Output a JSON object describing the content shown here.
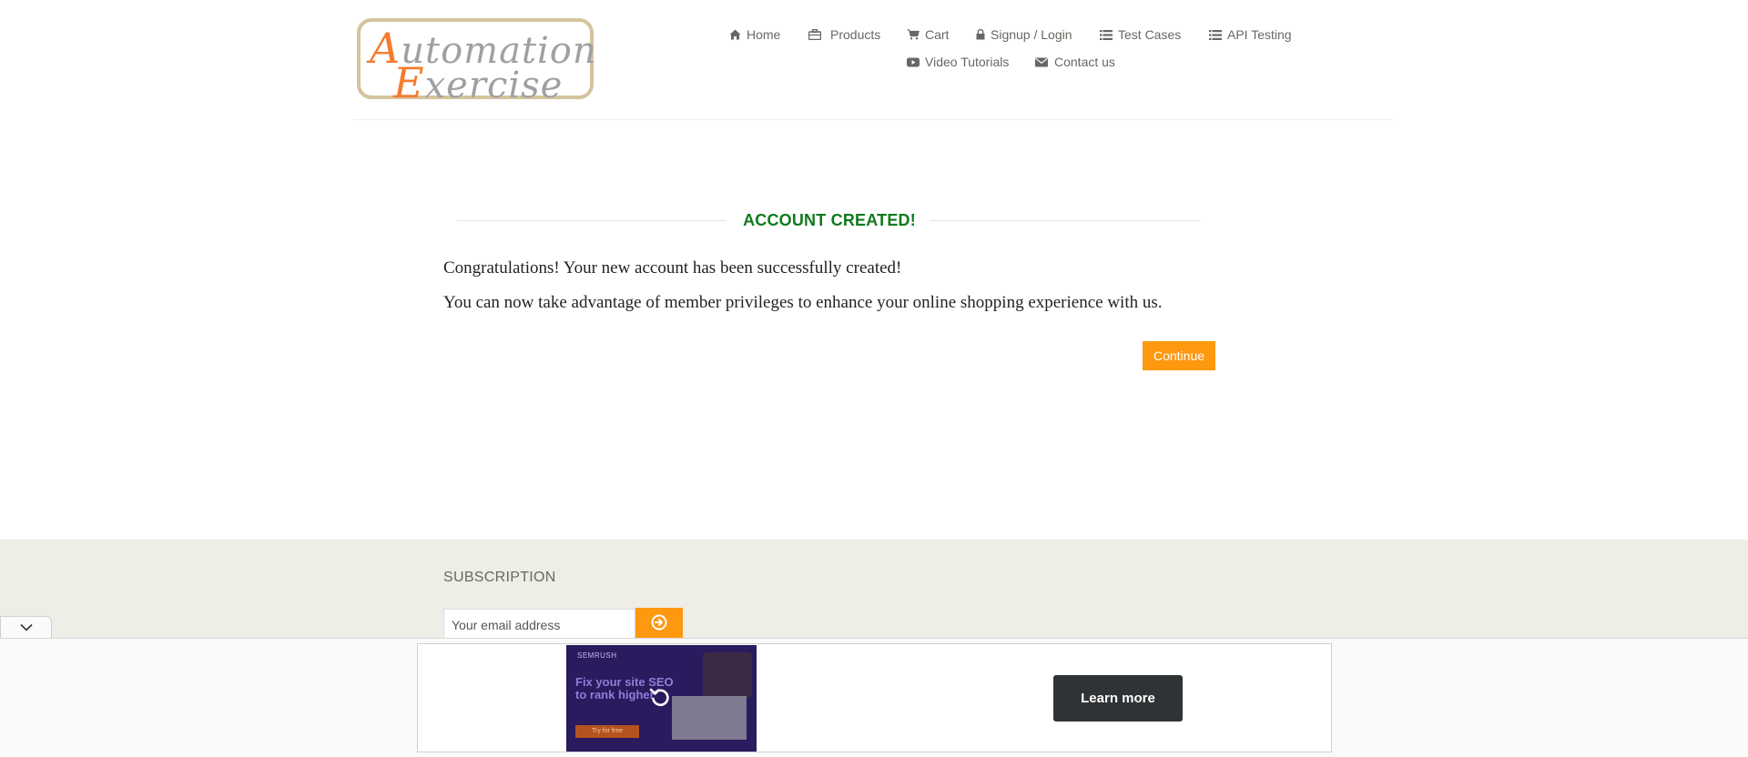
{
  "header": {
    "logo": {
      "line1": "Automation",
      "line2": "Exercise"
    },
    "nav": [
      {
        "id": "home",
        "label": "Home",
        "icon": "home-icon"
      },
      {
        "id": "products",
        "label": "Products",
        "icon": "briefcase-icon"
      },
      {
        "id": "cart",
        "label": "Cart",
        "icon": "cart-icon"
      },
      {
        "id": "signup",
        "label": "Signup / Login",
        "icon": "lock-icon"
      },
      {
        "id": "testcases",
        "label": "Test Cases",
        "icon": "list-icon"
      },
      {
        "id": "apitesting",
        "label": "API Testing",
        "icon": "list-icon"
      },
      {
        "id": "videos",
        "label": "Video Tutorials",
        "icon": "youtube-icon"
      },
      {
        "id": "contact",
        "label": "Contact us",
        "icon": "envelope-icon"
      }
    ]
  },
  "main": {
    "title": "ACCOUNT CREATED!",
    "message1": "Congratulations! Your new account has been successfully created!",
    "message2": "You can now take advantage of member privileges to enhance your online shopping experience with us.",
    "continue_label": "Continue"
  },
  "footer": {
    "subscription_title": "SUBSCRIPTION",
    "email_placeholder": "Your email address"
  },
  "ad": {
    "brand": "SEMRUSH",
    "headline": "Fix your site SEO to rank higher",
    "mini_button": "Try for free",
    "cta_label": "Learn more"
  },
  "colors": {
    "accent_orange": "#fe980f",
    "title_green": "#0f7a1c",
    "footer_bg": "#eeede6",
    "cta_dark": "#303335"
  }
}
